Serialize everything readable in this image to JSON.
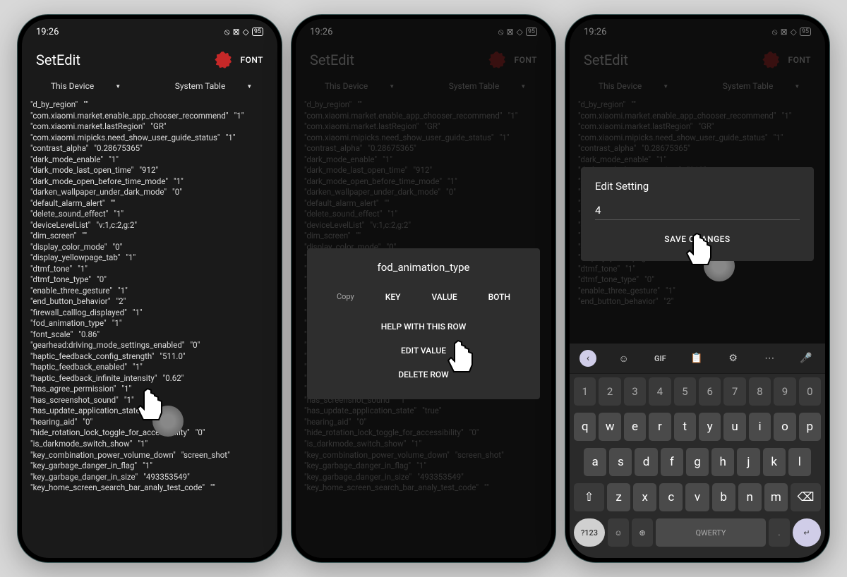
{
  "status": {
    "time": "19:26",
    "battery": "95"
  },
  "header": {
    "title": "SetEdit",
    "font_btn": "FONT"
  },
  "filters": {
    "device": "This Device",
    "table": "System Table"
  },
  "rows": [
    {
      "k": "d_by_region",
      "v": ""
    },
    {
      "k": "com.xiaomi.market.enable_app_chooser_recommend",
      "v": "1"
    },
    {
      "k": "com.xiaomi.market.lastRegion",
      "v": "GR"
    },
    {
      "k": "com.xiaomi.mipicks.need_show_user_guide_status",
      "v": "1"
    },
    {
      "k": "contrast_alpha",
      "v": "0.28675365"
    },
    {
      "k": "dark_mode_enable",
      "v": "1"
    },
    {
      "k": "dark_mode_last_open_time",
      "v": "912"
    },
    {
      "k": "dark_mode_open_before_time_mode",
      "v": "1"
    },
    {
      "k": "darken_wallpaper_under_dark_mode",
      "v": "0"
    },
    {
      "k": "default_alarm_alert",
      "v": ""
    },
    {
      "k": "delete_sound_effect",
      "v": "1"
    },
    {
      "k": "deviceLevelList",
      "v": "v:1,c:2,g:2"
    },
    {
      "k": "dim_screen",
      "v": ""
    },
    {
      "k": "display_color_mode",
      "v": "0"
    },
    {
      "k": "display_yellowpage_tab",
      "v": "1"
    },
    {
      "k": "dtmf_tone",
      "v": "1"
    },
    {
      "k": "dtmf_tone_type",
      "v": "0"
    },
    {
      "k": "enable_three_gesture",
      "v": "1"
    },
    {
      "k": "end_button_behavior",
      "v": "2"
    },
    {
      "k": "firewall_calllog_displayed",
      "v": "1"
    },
    {
      "k": "fod_animation_type",
      "v": "1"
    },
    {
      "k": "font_scale",
      "v": "0.86"
    },
    {
      "k": "gearhead:driving_mode_settings_enabled",
      "v": "0"
    },
    {
      "k": "haptic_feedback_config_strength",
      "v": "511.0"
    },
    {
      "k": "haptic_feedback_enabled",
      "v": "1"
    },
    {
      "k": "haptic_feedback_infinite_intensity",
      "v": "0.62"
    },
    {
      "k": "has_agree_permission",
      "v": "1"
    },
    {
      "k": "has_screenshot_sound",
      "v": "1"
    },
    {
      "k": "has_update_application_state",
      "v": "true"
    },
    {
      "k": "hearing_aid",
      "v": "0"
    },
    {
      "k": "hide_rotation_lock_toggle_for_accessibility",
      "v": "0"
    },
    {
      "k": "is_darkmode_switch_show",
      "v": "1"
    },
    {
      "k": "key_combination_power_volume_down",
      "v": "screen_shot"
    },
    {
      "k": "key_garbage_danger_in_flag",
      "v": "1"
    },
    {
      "k": "key_garbage_danger_in_size",
      "v": "493353549"
    },
    {
      "k": "key_home_screen_search_bar_analy_test_code",
      "v": ""
    }
  ],
  "context_dialog": {
    "title": "fod_animation_type",
    "copy": "Copy",
    "key": "KEY",
    "value": "VALUE",
    "both": "BOTH",
    "help": "HELP WITH THIS ROW",
    "edit": "EDIT VALUE",
    "delete": "DELETE ROW"
  },
  "edit_dialog": {
    "title": "Edit Setting",
    "value": "4",
    "save": "SAVE CHANGES"
  },
  "keyboard": {
    "nums": [
      "1",
      "2",
      "3",
      "4",
      "5",
      "6",
      "7",
      "8",
      "9",
      "0"
    ],
    "row1": [
      "q",
      "w",
      "e",
      "r",
      "t",
      "y",
      "u",
      "i",
      "o",
      "p"
    ],
    "row2": [
      "a",
      "s",
      "d",
      "f",
      "g",
      "h",
      "j",
      "k",
      "l"
    ],
    "row3": [
      "z",
      "x",
      "c",
      "v",
      "b",
      "n",
      "m"
    ],
    "mode": "?123",
    "space": "QWERTY",
    "gif": "GIF"
  }
}
